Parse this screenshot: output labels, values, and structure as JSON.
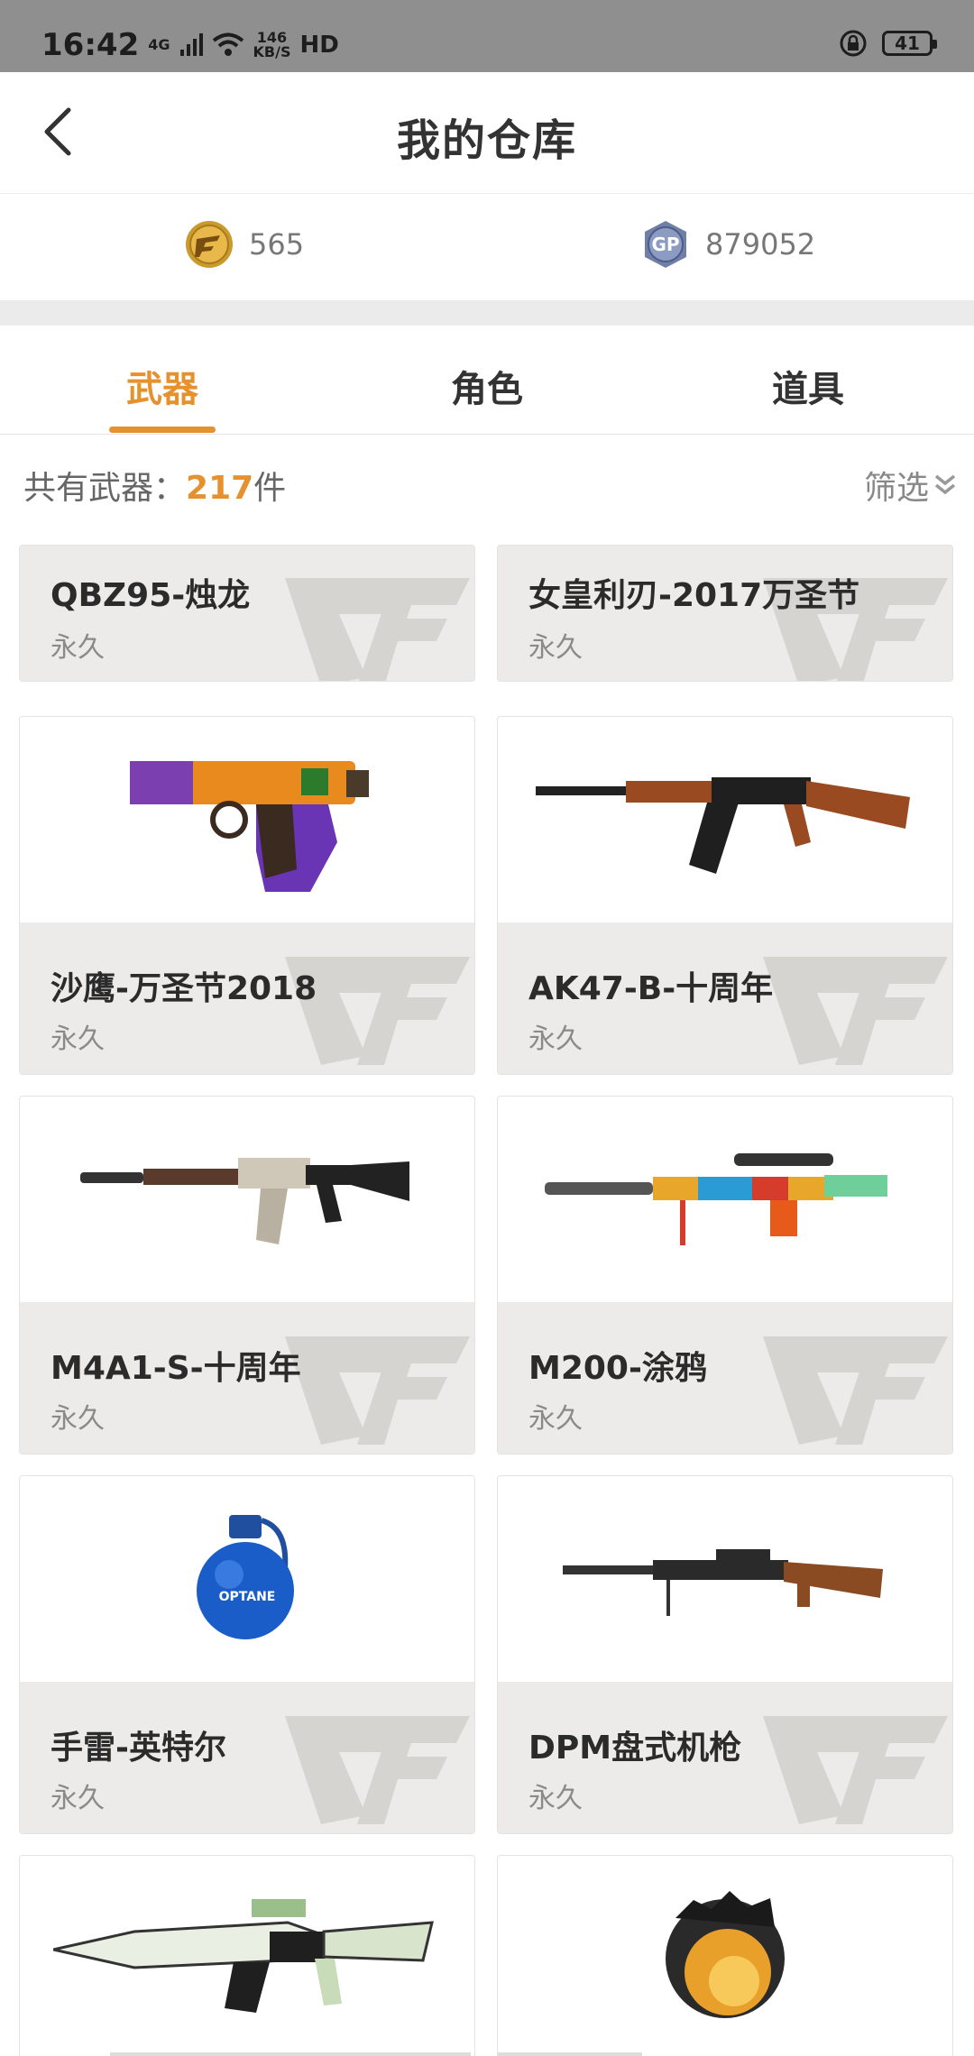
{
  "status_bar": {
    "time": "16:42",
    "network": "4G",
    "speed_value": "146",
    "speed_unit": "KB/S",
    "hd": "HD",
    "battery": "41"
  },
  "header": {
    "title": "我的仓库"
  },
  "currency": {
    "cf_amount": "565",
    "gp_label": "GP",
    "gp_amount": "879052"
  },
  "tabs": [
    {
      "label": "武器",
      "active": true
    },
    {
      "label": "角色",
      "active": false
    },
    {
      "label": "道具",
      "active": false
    }
  ],
  "summary": {
    "prefix": "共有武器：",
    "count": "217",
    "suffix": "件",
    "filter_label": "筛选"
  },
  "items": [
    {
      "name": "QBZ95-烛龙",
      "duration": "永久",
      "icon": "rifle-icon"
    },
    {
      "name": "女皇利刃-2017万圣节",
      "duration": "永久",
      "icon": "knife-icon"
    },
    {
      "name": "沙鹰-万圣节2018",
      "duration": "永久",
      "icon": "pistol-icon"
    },
    {
      "name": "AK47-B-十周年",
      "duration": "永久",
      "icon": "rifle-icon"
    },
    {
      "name": "M4A1-S-十周年",
      "duration": "永久",
      "icon": "rifle-icon"
    },
    {
      "name": "M200-涂鸦",
      "duration": "永久",
      "icon": "sniper-icon"
    },
    {
      "name": "手雷-英特尔",
      "duration": "永久",
      "icon": "grenade-icon",
      "grenade_text": "OPTANE"
    },
    {
      "name": "DPM盘式机枪",
      "duration": "永久",
      "icon": "machinegun-icon"
    },
    {
      "name": "",
      "duration": "",
      "icon": "rifle-icon"
    },
    {
      "name": "",
      "duration": "",
      "icon": "ornament-icon"
    }
  ],
  "colors": {
    "accent": "#e5912d",
    "statusbar": "#8f8f8f",
    "card_info_bg": "#ecebea"
  }
}
